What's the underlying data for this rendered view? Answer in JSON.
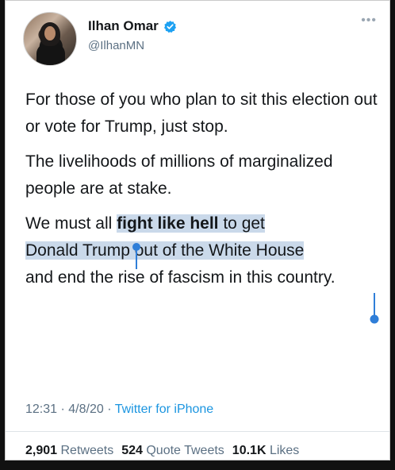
{
  "author": {
    "display_name": "Ilhan Omar",
    "handle": "@IlhanMN",
    "verified": true
  },
  "tweet": {
    "para1": "For those of you who plan to sit this election out or vote for Trump, just stop.",
    "para2": "The livelihoods of millions of marginalized people are at stake.",
    "para3_before": "We must all ",
    "para3_bold": "fight like hell",
    "para3_mid": " to get",
    "para3_line2": "Donald Trump out of the White House",
    "para3_after": "and end the rise of fascism in this country."
  },
  "meta": {
    "time": "12:31",
    "date": "4/8/20",
    "separator": "·",
    "source": "Twitter for iPhone"
  },
  "stats": {
    "retweets_count": "2,901",
    "retweets_label": "Retweets",
    "quotes_count": "524",
    "quotes_label": "Quote Tweets",
    "likes_count": "10.1K",
    "likes_label": "Likes"
  },
  "colors": {
    "link_blue": "#1b95e0",
    "verified_blue": "#1da1f2",
    "selection": "#cad9ea",
    "handle_blue": "#2f7ed8"
  },
  "icons": [
    "verified-badge-icon",
    "more-options-icon",
    "selection-start-handle-icon",
    "selection-end-handle-icon"
  ]
}
